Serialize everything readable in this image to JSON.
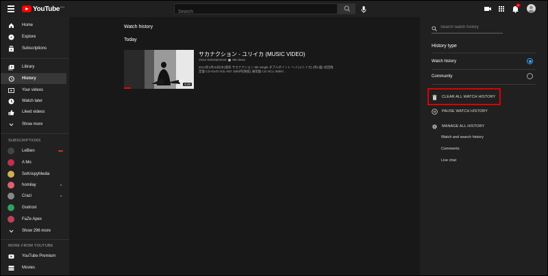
{
  "header": {
    "logo_text": "YouTube",
    "logo_sup": "PH",
    "search_placeholder": "Search",
    "notification_count": "9"
  },
  "sidebar": {
    "main_items": [
      {
        "label": "Home",
        "icon": "home-icon"
      },
      {
        "label": "Explore",
        "icon": "compass-icon"
      },
      {
        "label": "Subscriptions",
        "icon": "subscriptions-icon"
      }
    ],
    "library_items": [
      {
        "label": "Library",
        "icon": "library-icon"
      },
      {
        "label": "History",
        "icon": "history-icon",
        "active": true
      },
      {
        "label": "Your videos",
        "icon": "play-icon"
      },
      {
        "label": "Watch later",
        "icon": "clock-icon"
      },
      {
        "label": "Liked videos",
        "icon": "thumbs-up-icon"
      },
      {
        "label": "Show more",
        "icon": "chevron-down-icon"
      }
    ],
    "subscriptions_heading": "SUBSCRIPTIONS",
    "subscriptions": [
      {
        "label": "LeBien",
        "color": "#444444"
      },
      {
        "label": "A Mo",
        "color": "#c03050"
      },
      {
        "label": "SoKrispyMedia",
        "color": "#d0b050"
      },
      {
        "label": "homilay",
        "color": "#e06070"
      },
      {
        "label": "Crazi",
        "color": "#888888"
      },
      {
        "label": "Godrost",
        "color": "#30a060"
      },
      {
        "label": "FaZe Apex",
        "color": "#c04060"
      }
    ],
    "show_more_subs": "Show 296 more",
    "more_heading": "MORE FROM YOUTUBE",
    "more_items": [
      {
        "label": "YouTube Premium",
        "icon": "youtube-icon"
      },
      {
        "label": "Movies",
        "icon": "film-icon"
      }
    ]
  },
  "main": {
    "title": "Watch history",
    "section": "Today",
    "video": {
      "title": "サカナクション - ユリイカ (MUSIC VIDEO)",
      "channel": "Victor Entertainment",
      "views": "6M views",
      "duration": "5:25",
      "description": "2014年1月15日(水)発売 サカナクション 9th Single ダブルポイント ヘイ(ユリイカ) (両A面) 初回限定盤 CD+DVD VIZL-607 1800円(税抜) 通常盤 CD VICL-36857..."
    }
  },
  "panel": {
    "search_placeholder": "Search watch history",
    "history_type_label": "History type",
    "options": [
      {
        "label": "Watch history",
        "selected": true
      },
      {
        "label": "Community",
        "selected": false
      }
    ],
    "clear_label": "CLEAR ALL WATCH HISTORY",
    "pause_label": "PAUSE WATCH HISTORY",
    "manage_label": "MANAGE ALL HISTORY",
    "sub_links": [
      "Watch and search history",
      "Comments",
      "Live chat"
    ],
    "highlight_color": "#e00000"
  }
}
